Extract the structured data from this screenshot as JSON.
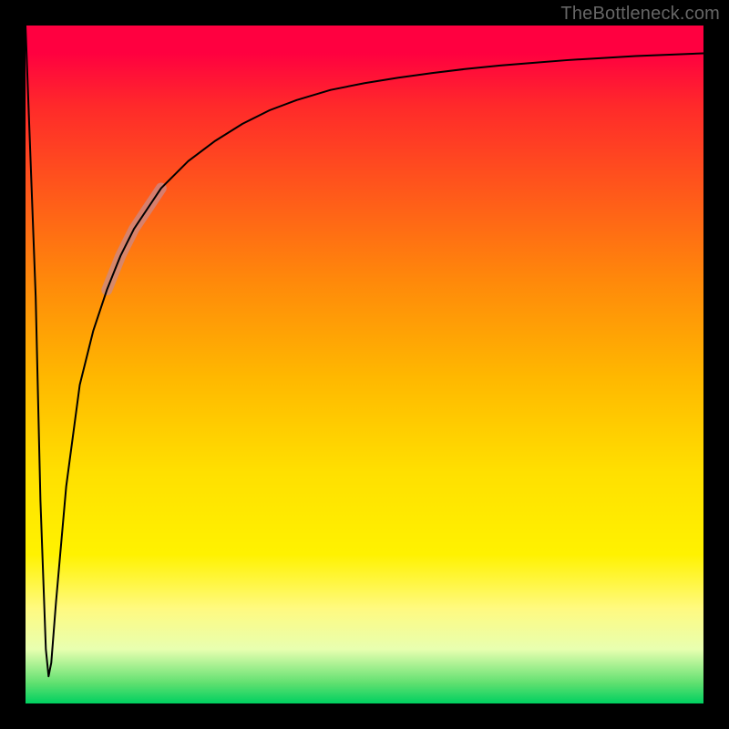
{
  "watermark": "TheBottleneck.com",
  "chart_data": {
    "type": "line",
    "title": "",
    "xlabel": "",
    "ylabel": "",
    "xlim": [
      0,
      100
    ],
    "ylim": [
      0,
      100
    ],
    "grid": false,
    "background_gradient": {
      "top_color": "#ff0040",
      "bottom_color": "#00d060",
      "description": "vertical gradient red (top) through orange and yellow to green (bottom)"
    },
    "series": [
      {
        "name": "bottleneck-curve",
        "color": "#000000",
        "stroke_width": 2,
        "x": [
          0,
          1.5,
          2.2,
          3.0,
          3.4,
          3.8,
          4.5,
          6,
          8,
          10,
          12,
          14,
          16,
          18,
          20,
          24,
          28,
          32,
          36,
          40,
          45,
          50,
          55,
          60,
          65,
          70,
          75,
          80,
          85,
          90,
          95,
          100
        ],
        "values": [
          100,
          60,
          30,
          8,
          4,
          6,
          15,
          32,
          47,
          55,
          61,
          66,
          70,
          73,
          76,
          80,
          83,
          85.5,
          87.5,
          89,
          90.5,
          91.5,
          92.3,
          93,
          93.6,
          94.1,
          94.5,
          94.9,
          95.2,
          95.5,
          95.7,
          95.9
        ]
      },
      {
        "name": "highlight-segment",
        "color": "#c98a8a",
        "opacity": 0.75,
        "stroke_width": 12,
        "x": [
          12,
          14,
          16,
          18,
          20
        ],
        "values": [
          61,
          66,
          70,
          73,
          76
        ]
      }
    ],
    "annotations": []
  }
}
